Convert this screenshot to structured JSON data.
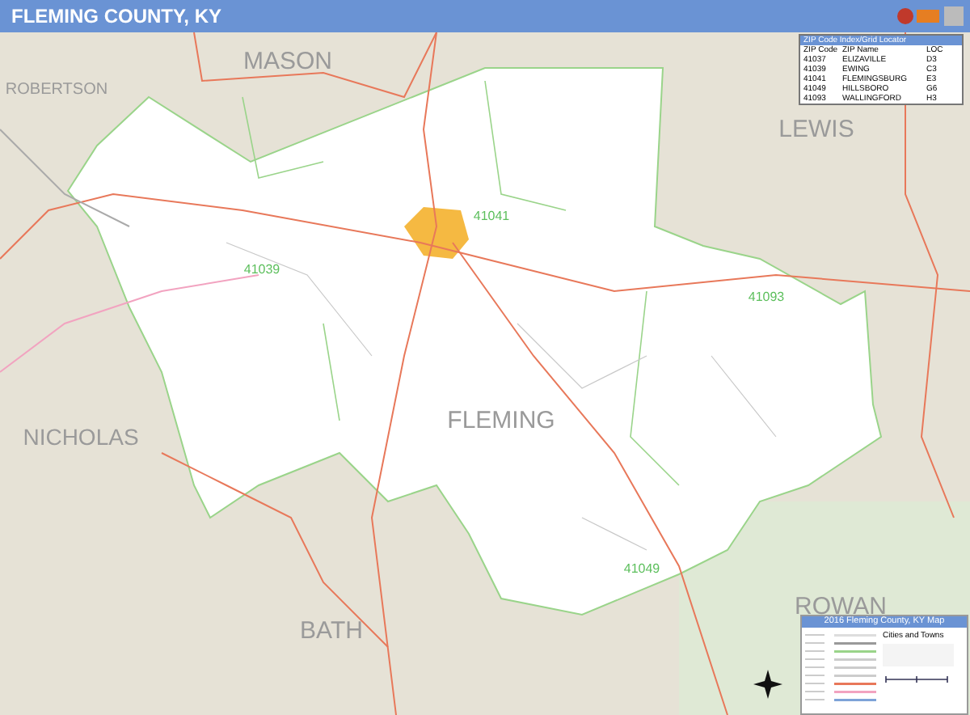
{
  "header": {
    "title": "FLEMING COUNTY, KY"
  },
  "map": {
    "counties": [
      "MASON",
      "ROBERTSON",
      "LEWIS",
      "NICHOLAS",
      "FLEMING",
      "BATH",
      "ROWAN"
    ],
    "zip_labels": [
      "41041",
      "41039",
      "41093",
      "41049"
    ]
  },
  "zip_index": {
    "title": "ZIP Code Index/Grid Locator",
    "columns": [
      "ZIP Code",
      "ZIP Name",
      "LOC"
    ],
    "rows": [
      [
        "41037",
        "ELIZAVILLE",
        "D3"
      ],
      [
        "41039",
        "EWING",
        "C3"
      ],
      [
        "41041",
        "FLEMINGSBURG",
        "E3"
      ],
      [
        "41049",
        "HILLSBORO",
        "G6"
      ],
      [
        "41093",
        "WALLINGFORD",
        "H3"
      ]
    ]
  },
  "legend": {
    "title": "2016 Fleming County, KY Map",
    "section": "Cities and Towns"
  }
}
